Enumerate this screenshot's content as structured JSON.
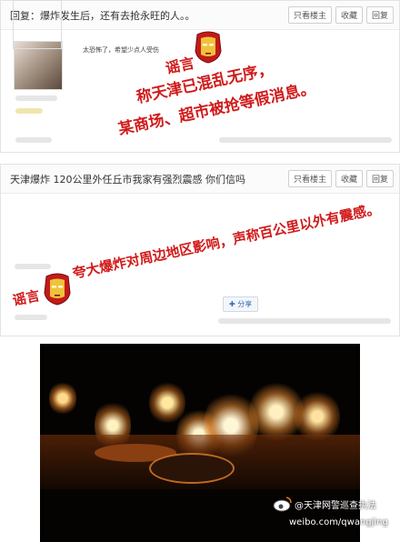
{
  "post1": {
    "title": "回复：爆炸发生后，还有去抢永旺的人。。",
    "buttons": [
      "只看楼主",
      "收藏",
      "回复"
    ],
    "reply_snippet": "太恐怖了，希望少点人受伤"
  },
  "post2": {
    "title": "天津爆炸 120公里外任丘市我家有强烈震感 你们信吗",
    "buttons": [
      "只看楼主",
      "收藏",
      "回复"
    ],
    "share_label": "分享"
  },
  "annotations": {
    "rumor_label": "谣言",
    "rumor1_line1": "称天津已混乱无序，",
    "rumor1_line2": "某商场、超市被抢等假消息。",
    "rumor2_text": "夸大爆炸对周边地区影响，声称百公里以外有震感。"
  },
  "watermark": {
    "handle": "@天津网警巡查执法",
    "url": "weibo.com/qwangjing"
  },
  "colors": {
    "rumor_red": "#d11a1a"
  },
  "icons": [
    "ironman-mask-icon",
    "weibo-logo-icon"
  ]
}
